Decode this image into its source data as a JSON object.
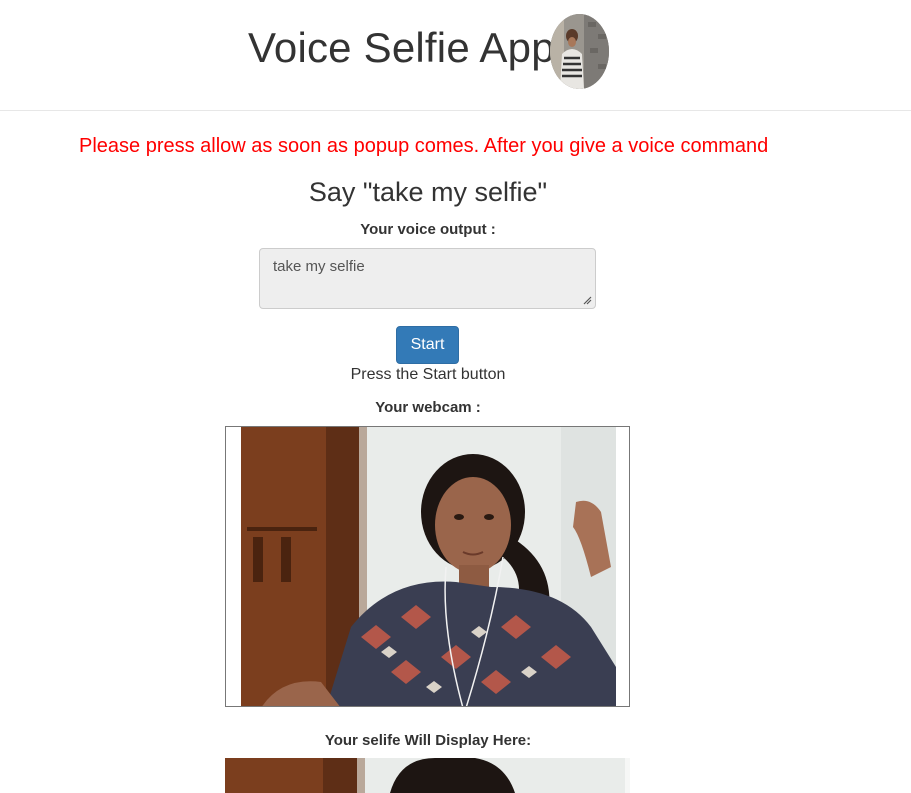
{
  "header": {
    "title": "Voice Selfie App",
    "avatar_icon": "profile-photo-icon"
  },
  "notice": {
    "text": "Please press allow as soon as popup comes. After you give a voice command",
    "color": "#ff0000"
  },
  "voice": {
    "heading": "Say \"take my selfie\"",
    "label": "Your voice output :",
    "value": "take my selfie"
  },
  "controls": {
    "start_label": "Start",
    "hint": "Press the Start button",
    "button_color": "#337ab7"
  },
  "webcam": {
    "label": "Your webcam :"
  },
  "selfie": {
    "label": "Your selife Will Display Here:"
  }
}
